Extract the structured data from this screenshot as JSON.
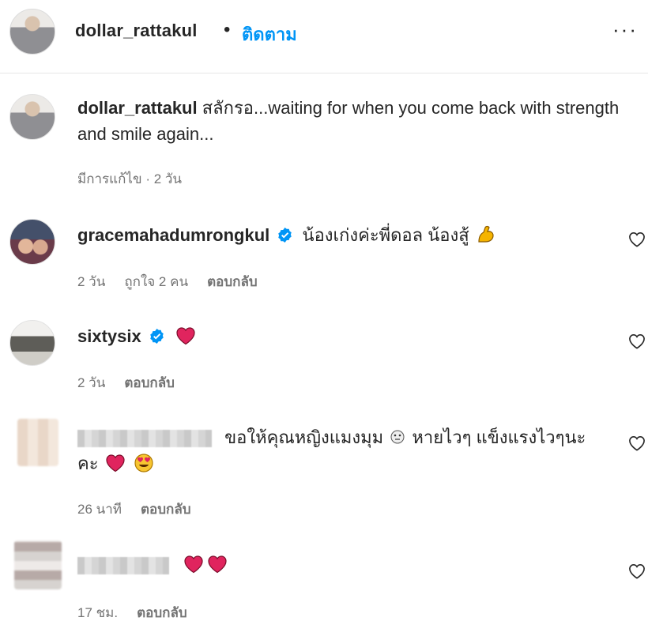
{
  "header": {
    "username": "dollar_rattakul",
    "separator": "•",
    "follow_label": "ติดตาม",
    "more_label": "···"
  },
  "caption": {
    "username": "dollar_rattakul",
    "text": "สลักรอ...waiting for when you come back with strength and smile again...",
    "meta": "มีการแก้ไข · 2 วัน"
  },
  "comments": [
    {
      "username": "gracemahadumrongkul",
      "verified": true,
      "text": "น้องเก่งค่ะพี่ดอล น้องสู้",
      "emoji": [
        "flexed-biceps"
      ],
      "time": "2 วัน",
      "likes": "ถูกใจ 2 คน",
      "reply": "ตอบกลับ"
    },
    {
      "username": "sixtysix",
      "verified": true,
      "text": "",
      "emoji": [
        "red-heart"
      ],
      "time": "2 วัน",
      "reply": "ตอบกลับ"
    },
    {
      "username_hidden": true,
      "line1": "ขอให้คุณหญิงแมงมุม",
      "line1b": "หายไวๆ แข็งแรงไวๆนะ",
      "line2": "คะ",
      "emoji": [
        "face-emoji",
        "red-heart",
        "heart-eyes"
      ],
      "time": "26 นาที",
      "reply": "ตอบกลับ"
    },
    {
      "username_hidden": true,
      "emoji": [
        "red-heart",
        "red-heart"
      ],
      "time": "17 ชม.",
      "reply": "ตอบกลับ"
    }
  ],
  "colors": {
    "text": "#262626",
    "secondary": "#737373",
    "link": "#0095f6",
    "verified": "#0095f6",
    "heart": "#e0245e",
    "divider": "#e6e6e6"
  },
  "icons": {
    "like": "heart-outline-icon",
    "verified": "verified-badge-icon",
    "more": "more-options-icon"
  }
}
